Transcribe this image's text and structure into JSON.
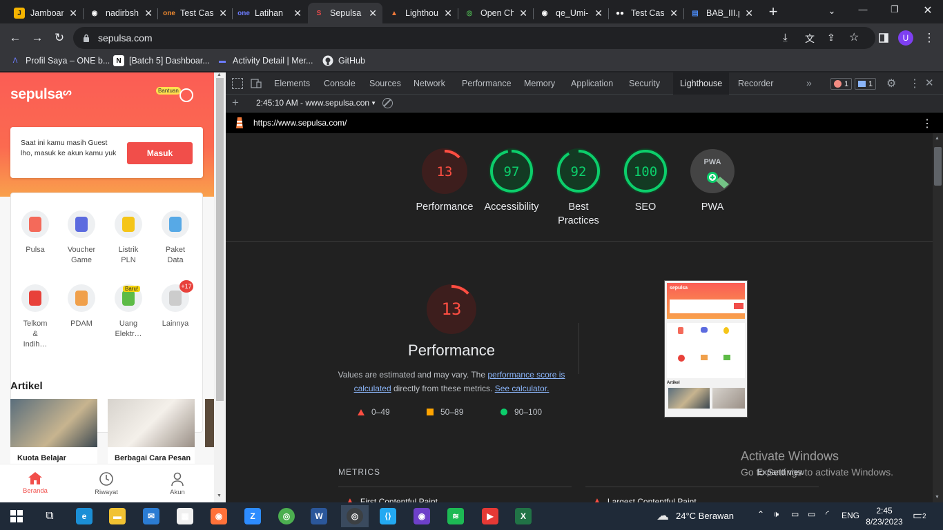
{
  "browser": {
    "tabs": [
      {
        "title": "Jamboar",
        "fav": "J",
        "color": "#f5b400",
        "fg": "#202124"
      },
      {
        "title": "nadirbsh",
        "fav": "◉",
        "color": "#202124",
        "fg": "#ffffff"
      },
      {
        "title": "Test Cas",
        "fav": "one",
        "color": "#202124",
        "fg": "#f28b30"
      },
      {
        "title": "Latihan",
        "fav": "one",
        "color": "#202124",
        "fg": "#6c7cff"
      },
      {
        "title": "Sepulsa",
        "fav": "S",
        "color": "#35363a",
        "fg": "#ef4b4b"
      },
      {
        "title": "Lighthou",
        "fav": "▲",
        "color": "#202124",
        "fg": "#f37a3a"
      },
      {
        "title": "Open Ch",
        "fav": "◎",
        "color": "#202124",
        "fg": "#4caf50"
      },
      {
        "title": "qe_Umi-",
        "fav": "◉",
        "color": "#202124",
        "fg": "#ffffff"
      },
      {
        "title": "Test Cas",
        "fav": "●●",
        "color": "#202124",
        "fg": "#ffffff"
      },
      {
        "title": "BAB_III.p",
        "fav": "▤",
        "color": "#202124",
        "fg": "#4a8af4"
      }
    ],
    "active_tab": 4,
    "new_tab": "+",
    "url": "sepulsa.com",
    "profile_initial": "U",
    "bookmarks": [
      "Profil Saya – ONE b...",
      "[Batch 5] Dashboar...",
      "Activity Detail | Mer...",
      "GitHub"
    ]
  },
  "sepulsa": {
    "logo": "sepulsa",
    "help": "Bantuan",
    "guest_text": "Saat ini kamu masih Guest lho, masuk ke akun kamu yuk",
    "login_button": "Masuk",
    "services": [
      {
        "label": "Pulsa",
        "icon": "phone-icon",
        "color": "#f46a5a"
      },
      {
        "label": "Voucher Game",
        "icon": "gamepad-icon",
        "color": "#5c6bdf"
      },
      {
        "label": "Listrik PLN",
        "icon": "bulb-icon",
        "color": "#f5c518"
      },
      {
        "label": "Paket Data",
        "icon": "data-phone-icon",
        "color": "#57a9e6"
      },
      {
        "label": "Telkom & Indih…",
        "icon": "telephone-icon",
        "color": "#e8413a"
      },
      {
        "label": "PDAM",
        "icon": "faucet-icon",
        "color": "#f0a04b"
      },
      {
        "label": "Uang Elektr…",
        "icon": "wallet-icon",
        "color": "#5dbb46"
      },
      {
        "label": "Lainnya",
        "icon": "more-icon",
        "color": "#cccccc"
      }
    ],
    "new_badge": "Baru!",
    "more_badge": "+17",
    "articles_title": "Artikel",
    "articles": [
      "Kuota Belajar",
      "Berbagai Cara Pesan"
    ],
    "nav": [
      "Beranda",
      "Riwayat",
      "Akun"
    ]
  },
  "devtools": {
    "tabs": [
      "Elements",
      "Console",
      "Sources",
      "Network",
      "Performance",
      "Memory",
      "Application",
      "Security",
      "Lighthouse",
      "Recorder"
    ],
    "active": "Lighthouse",
    "error_count": "1",
    "message_count": "1",
    "report_select": "2:45:10 AM - www.sepulsa.con",
    "report_url": "https://www.sepulsa.com/",
    "scores": [
      {
        "value": "13",
        "label": "Performance",
        "color": "#ff4e42",
        "fraction": 0.13
      },
      {
        "value": "97",
        "label": "Accessibility",
        "color": "#0cce6b",
        "fraction": 0.97
      },
      {
        "value": "92",
        "label": "Best Practices",
        "color": "#0cce6b",
        "fraction": 0.92
      },
      {
        "value": "100",
        "label": "SEO",
        "color": "#0cce6b",
        "fraction": 1.0
      },
      {
        "value": "",
        "label": "PWA",
        "color": "#9aa0a6",
        "fraction": 0
      }
    ],
    "pwa_badge": "PWA",
    "perf_score": "13",
    "perf_title": "Performance",
    "perf_desc_1": "Values are estimated and may vary. The",
    "perf_link_1": "performance score is calculated",
    "perf_desc_2": "directly from these metrics.",
    "perf_link_2": "See calculator.",
    "legend": [
      {
        "range": "0–49",
        "color": "#ff4e42",
        "shape": "triangle"
      },
      {
        "range": "50–89",
        "color": "#ffa400",
        "shape": "square"
      },
      {
        "range": "90–100",
        "color": "#0cce6b",
        "shape": "circle"
      }
    ],
    "metrics_title": "METRICS",
    "expand_view": "Expand view",
    "metric_1": "First Contentful Paint",
    "metric_2": "Largest Contentful Paint"
  },
  "watermark": {
    "title": "Activate Windows",
    "subtitle": "Go to Settings to activate Windows."
  },
  "taskbar": {
    "weather": "24°C  Berawan",
    "lang": "ENG",
    "time": "2:45",
    "date": "8/23/2023",
    "notif": "2"
  }
}
